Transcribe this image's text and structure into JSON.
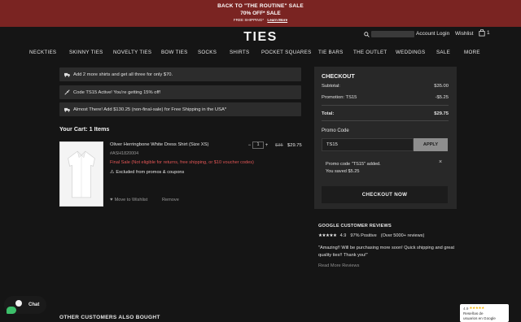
{
  "promo_bar": {
    "line1": "BACK TO \"THE ROUTINE\" SALE",
    "line2": "70% OFF* SALE",
    "line3": "FREE SHIPPING*",
    "learn_more": "Learn More"
  },
  "header": {
    "logo": "TIES",
    "account": "Account Login",
    "wishlist": "Wishlist",
    "bag_count": "1"
  },
  "nav": [
    "NECKTIES",
    "SKINNY TIES",
    "NOVELTY TIES",
    "BOW TIES",
    "SOCKS",
    "SHIRTS",
    "POCKET SQUARES",
    "TIE BARS",
    "THE OUTLET",
    "WEDDINGS",
    "SALE",
    "MORE"
  ],
  "messages": [
    {
      "icon": "truck-icon",
      "text": "Add 2 more shirts and get all three for only $70."
    },
    {
      "icon": "tag-icon",
      "text": "Code TS15 Active! You're getting 15% off!"
    },
    {
      "icon": "truck-icon",
      "text": "Almost There! Add $130.25 (non-final-sale) for Free Shipping in the USA*"
    }
  ],
  "cart": {
    "title": "Your Cart: 1 Items",
    "item": {
      "name": "Oliver Herringbone White Dress Shirt (Size XS)",
      "sku": "#ASH1820004",
      "final_sale": "Final Sale (Not eligible for returns, free shipping, or $10 voucher codes)",
      "excluded": "Excluded from promos & coupons",
      "quantity": "1",
      "price_old": "$35",
      "price_new": "$29.75",
      "move_to_wishlist": "Move to Wishlist",
      "remove": "Remove"
    }
  },
  "checkout": {
    "title": "CHECKOUT",
    "subtotal_label": "Subtotal:",
    "subtotal_value": "$35.00",
    "promotion_label": "Promotion: TS15",
    "promotion_value": "-$5.25",
    "total_label": "Total:",
    "total_value": "$29.75",
    "promo_label": "Promo Code",
    "promo_value": "TS15",
    "apply": "APPLY",
    "note_line1": "Promo code \"TS15\" added.",
    "note_line2": "You saved $5.25",
    "close": "×",
    "checkout_button": "CHECKOUT NOW"
  },
  "reviews": {
    "title": "GOOGLE CUSTOMER REVIEWS",
    "stars": "★★★★★",
    "score": "4.9",
    "positive": "97% Positive",
    "count": "(Over 5000+ reviews)",
    "quote": "\"Amazing!! Will be purchasing more soon! Quick shipping and great quality ties!! Thank you!\"",
    "read_more": "Read More Reviews"
  },
  "also_bought": "OTHER CUSTOMERS ALSO BOUGHT",
  "chat": {
    "label": "Chat"
  },
  "badge": {
    "score": "4.9",
    "stars": "★★★★★",
    "line1": "Reseñas de",
    "line2": "usuarios en Google"
  }
}
